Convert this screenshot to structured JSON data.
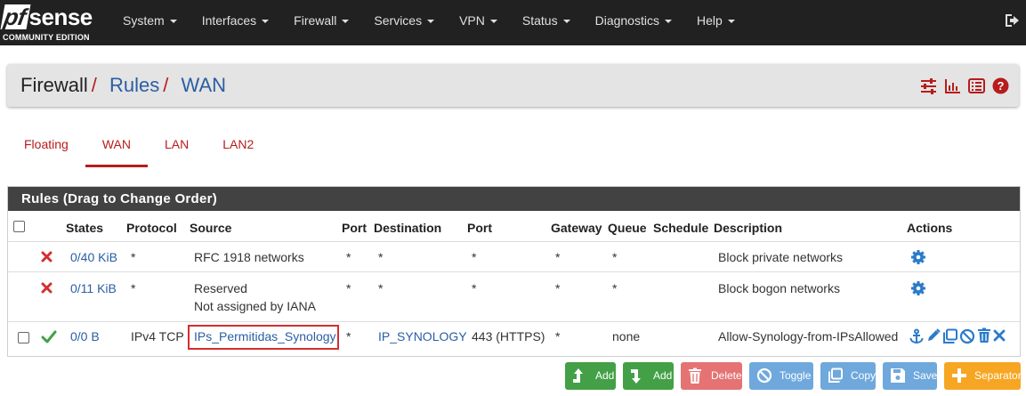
{
  "nav": {
    "logo_main_left": "pf",
    "logo_main_right": "sense",
    "logo_sub": "COMMUNITY EDITION",
    "items": [
      {
        "label": "System"
      },
      {
        "label": "Interfaces"
      },
      {
        "label": "Firewall"
      },
      {
        "label": "Services"
      },
      {
        "label": "VPN"
      },
      {
        "label": "Status"
      },
      {
        "label": "Diagnostics"
      },
      {
        "label": "Help"
      }
    ],
    "logout_icon": "logout-icon"
  },
  "breadcrumb": {
    "root": "Firewall",
    "sep1": "/",
    "link1": "Rules",
    "sep2": "/",
    "link2": "WAN"
  },
  "header_icons": [
    "sliders-icon",
    "bar-chart-icon",
    "list-icon",
    "help-icon"
  ],
  "tabs": [
    {
      "label": "Floating",
      "active": false
    },
    {
      "label": "WAN",
      "active": true
    },
    {
      "label": "LAN",
      "active": false
    },
    {
      "label": "LAN2",
      "active": false
    }
  ],
  "rules_panel": {
    "title": "Rules (Drag to Change Order)",
    "columns": {
      "states": "States",
      "protocol": "Protocol",
      "source": "Source",
      "port": "Port",
      "destination": "Destination",
      "port2": "Port",
      "gateway": "Gateway",
      "queue": "Queue",
      "schedule": "Schedule",
      "description": "Description",
      "actions": "Actions"
    },
    "rows": [
      {
        "status": "block",
        "states": "0/40 KiB",
        "protocol": "*",
        "source": "RFC 1918 networks",
        "source_line2": "",
        "port": "*",
        "destination": "*",
        "dest_port": "*",
        "gateway": "*",
        "queue": "*",
        "schedule": "",
        "description": "Block private networks"
      },
      {
        "status": "block",
        "states": "0/11 KiB",
        "protocol": "*",
        "source": "Reserved",
        "source_line2": "Not assigned by IANA",
        "port": "*",
        "destination": "*",
        "dest_port": "*",
        "gateway": "*",
        "queue": "*",
        "schedule": "",
        "description": "Block bogon networks"
      },
      {
        "status": "pass",
        "states": "0/0 B",
        "protocol": "IPv4 TCP",
        "source": "IPs_Permitidas_Synology",
        "source_line2": "",
        "port": "*",
        "destination": "IP_SYNOLOGY",
        "dest_port": "443 (HTTPS)",
        "gateway": "*",
        "queue": "none",
        "schedule": "",
        "description": "Allow-Synology-from-IPsAllowed"
      }
    ]
  },
  "buttons": {
    "add_top": "Add",
    "add_bottom": "Add",
    "delete": "Delete",
    "toggle": "Toggle",
    "copy": "Copy",
    "save": "Save",
    "separator": "Separator"
  },
  "colors": {
    "navbar": "#212121",
    "accent_red": "#b71c1c",
    "link_blue": "#2b5ea3",
    "pass_green": "#43a047",
    "block_red": "#d32f2f"
  }
}
